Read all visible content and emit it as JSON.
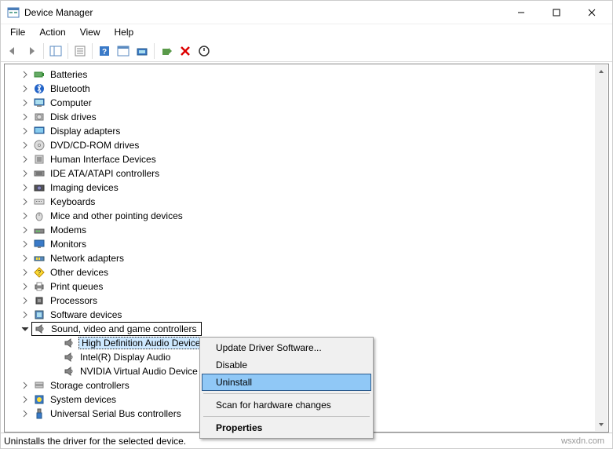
{
  "window": {
    "title": "Device Manager"
  },
  "menubar": {
    "file": "File",
    "action": "Action",
    "view": "View",
    "help": "Help"
  },
  "tree": {
    "items": [
      {
        "label": "Batteries"
      },
      {
        "label": "Bluetooth"
      },
      {
        "label": "Computer"
      },
      {
        "label": "Disk drives"
      },
      {
        "label": "Display adapters"
      },
      {
        "label": "DVD/CD-ROM drives"
      },
      {
        "label": "Human Interface Devices"
      },
      {
        "label": "IDE ATA/ATAPI controllers"
      },
      {
        "label": "Imaging devices"
      },
      {
        "label": "Keyboards"
      },
      {
        "label": "Mice and other pointing devices"
      },
      {
        "label": "Modems"
      },
      {
        "label": "Monitors"
      },
      {
        "label": "Network adapters"
      },
      {
        "label": "Other devices"
      },
      {
        "label": "Print queues"
      },
      {
        "label": "Processors"
      },
      {
        "label": "Software devices"
      }
    ],
    "expanded": {
      "label": "Sound, video and game controllers",
      "children": [
        {
          "label": "High Definition Audio Device"
        },
        {
          "label": "Intel(R) Display Audio"
        },
        {
          "label": "NVIDIA Virtual Audio Device ("
        }
      ]
    },
    "after": [
      {
        "label": "Storage controllers"
      },
      {
        "label": "System devices"
      },
      {
        "label": "Universal Serial Bus controllers"
      }
    ]
  },
  "context_menu": {
    "update": "Update Driver Software...",
    "disable": "Disable",
    "uninstall": "Uninstall",
    "scan": "Scan for hardware changes",
    "properties": "Properties"
  },
  "statusbar": {
    "text": "Uninstalls the driver for the selected device.",
    "watermark": "wsxdn.com"
  }
}
